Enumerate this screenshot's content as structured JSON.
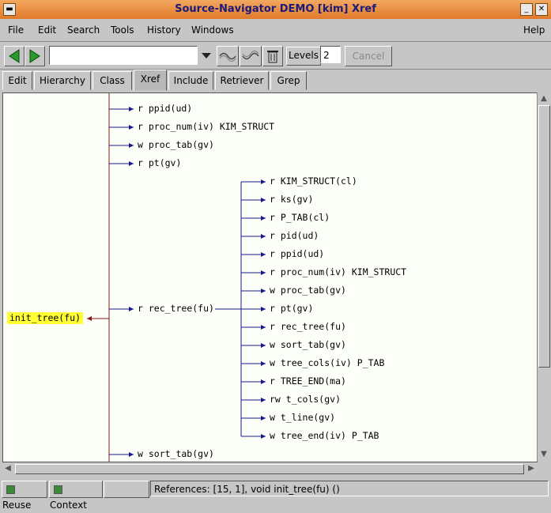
{
  "window": {
    "title": "Source-Navigator DEMO [kim] Xref"
  },
  "menu": {
    "file": "File",
    "edit": "Edit",
    "search": "Search",
    "tools": "Tools",
    "history": "History",
    "windows": "Windows",
    "help": "Help"
  },
  "toolbar": {
    "levels_label": "Levels",
    "levels_value": "2",
    "cancel_label": "Cancel",
    "search_value": ""
  },
  "tabs": [
    "Edit",
    "Hierarchy",
    "Class",
    "Xref",
    "Include",
    "Retriever",
    "Grep"
  ],
  "xref": {
    "root": "init_tree(fu)",
    "level1": [
      "r ppid(ud)",
      "r proc_num(iv) KIM_STRUCT",
      "w proc_tab(gv)",
      "r pt(gv)",
      "r rec_tree(fu)",
      "w sort_tab(gv)"
    ],
    "level2": [
      "r KIM_STRUCT(cl)",
      "r ks(gv)",
      "r P_TAB(cl)",
      "r pid(ud)",
      "r ppid(ud)",
      "r proc_num(iv) KIM_STRUCT",
      "w proc_tab(gv)",
      "r pt(gv)",
      "r rec_tree(fu)",
      "w sort_tab(gv)",
      "w tree_cols(iv) P_TAB",
      "r TREE_END(ma)",
      "rw t_cols(gv)",
      "w t_line(gv)",
      "w tree_end(iv) P_TAB"
    ]
  },
  "status": {
    "reuse": "Reuse",
    "context": "Context",
    "references": "References: [15, 1], void  init_tree(fu) ()"
  }
}
